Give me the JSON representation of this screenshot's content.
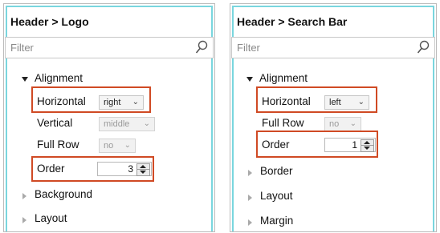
{
  "left_panel": {
    "title": "Header > Logo",
    "filter_placeholder": "Filter",
    "section": "Alignment",
    "horizontal_label": "Horizontal",
    "horizontal_value": "right",
    "vertical_label": "Vertical",
    "vertical_value": "middle",
    "fullrow_label": "Full Row",
    "fullrow_value": "no",
    "order_label": "Order",
    "order_value": "3",
    "collapsed": [
      "Background",
      "Layout"
    ]
  },
  "right_panel": {
    "title": "Header > Search Bar",
    "filter_placeholder": "Filter",
    "section": "Alignment",
    "horizontal_label": "Horizontal",
    "horizontal_value": "left",
    "fullrow_label": "Full Row",
    "fullrow_value": "no",
    "order_label": "Order",
    "order_value": "1",
    "collapsed": [
      "Border",
      "Layout",
      "Margin"
    ]
  },
  "icons": {
    "search": "search-icon",
    "expanded": "triangle-down-icon",
    "collapsed": "triangle-right-icon",
    "dropdown": "chevron-down-icon",
    "spinner": "spinner-arrows-icon"
  },
  "colors": {
    "highlight": "#d04a24",
    "panel_inner_border": "#79d6de"
  }
}
